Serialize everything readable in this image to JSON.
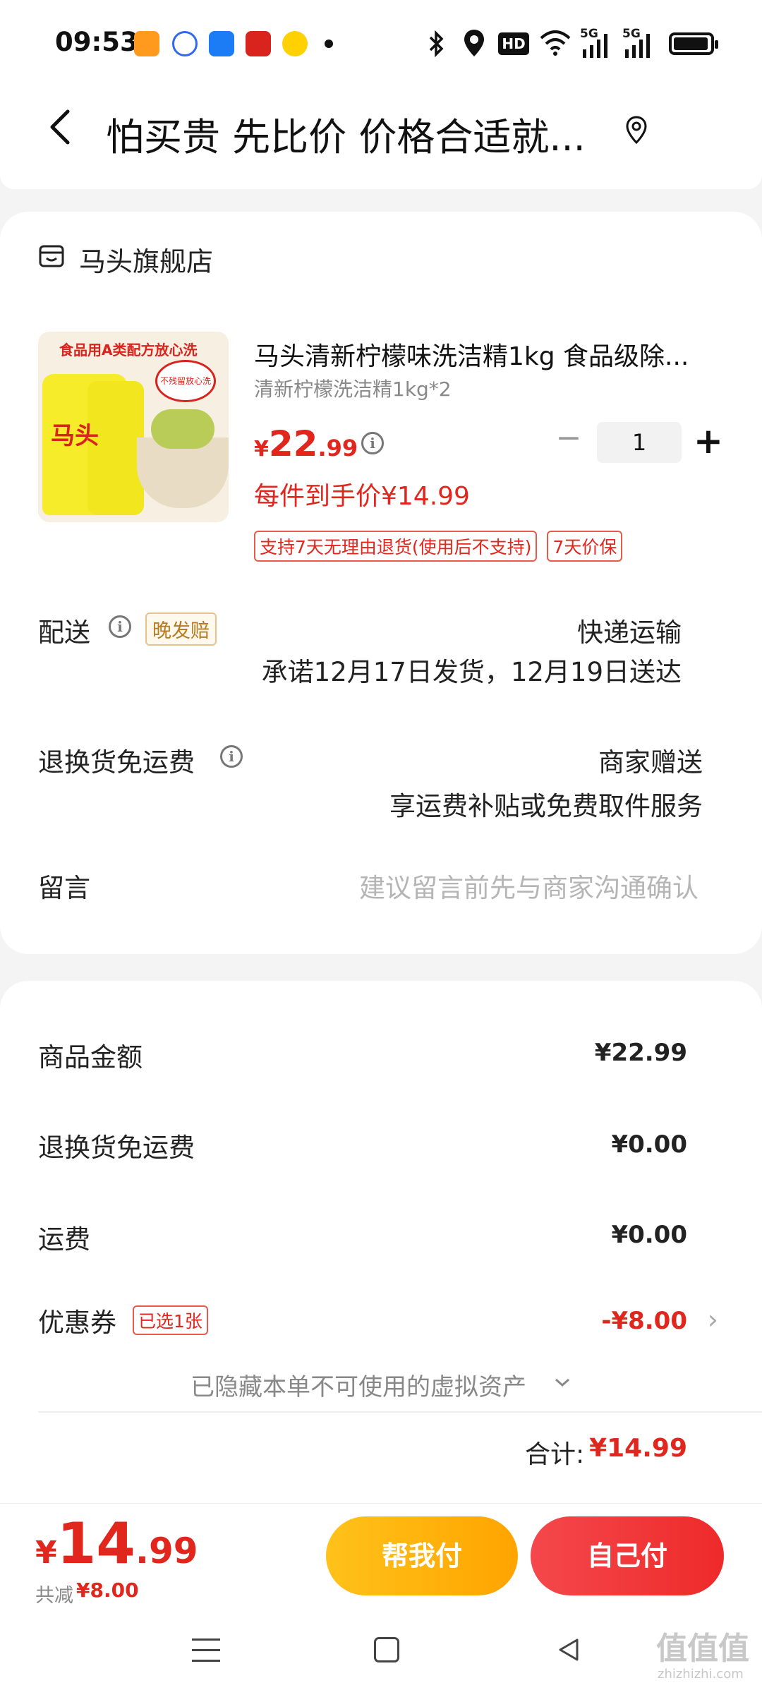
{
  "status_bar": {
    "time": "09:53",
    "hd_label": "HD",
    "net1": "5G",
    "net2": "5G",
    "battery_level": 0.95,
    "app_icons": [
      "taobao-icon",
      "baidu-icon",
      "phone-app-icon",
      "xuexi-app-icon",
      "meituan-icon"
    ]
  },
  "header": {
    "title": "怕买贵 先比价 价格合适就..."
  },
  "order": {
    "shop_name": "马头旗舰店",
    "product": {
      "image_text": "食品用A类配方放心洗",
      "image_badge": "不残留放心洗",
      "image_brand": "马头",
      "title": "马头清新柠檬味洗洁精1kg 食品级除...",
      "spec": "清新柠檬洗洁精1kg*2",
      "price_symbol": "¥",
      "price_int": "22",
      "price_dec": ".99",
      "final_price": "每件到手价¥14.99",
      "quantity": "1",
      "tags": [
        "支持7天无理由退货(使用后不支持)",
        "7天价保"
      ]
    },
    "delivery": {
      "label": "配送",
      "badge": "晚发赔",
      "method": "快递运输",
      "promise": "承诺12月17日发货，12月19日送达"
    },
    "return_shipping": {
      "label": "退换货免运费",
      "value": "商家赠送",
      "desc": "享运费补贴或免费取件服务"
    },
    "note": {
      "label": "留言",
      "placeholder": "建议留言前先与商家沟通确认"
    }
  },
  "summary": {
    "goods_label": "商品金额",
    "goods_value": "¥22.99",
    "return_label": "退换货免运费",
    "return_value": "¥0.00",
    "shipping_label": "运费",
    "shipping_value": "¥0.00",
    "coupon_label": "优惠券",
    "coupon_badge": "已选1张",
    "coupon_value": "-¥8.00",
    "hidden_assets": "已隐藏本单不可使用的虚拟资产",
    "total_label": "合计:",
    "total_value": "¥14.99"
  },
  "bottom_bar": {
    "price_symbol": "¥",
    "price_int": "14",
    "price_dec": ".99",
    "saved_label": "共减",
    "saved_value": "¥8.00",
    "help_pay": "帮我付",
    "self_pay": "自己付"
  },
  "watermark": {
    "text": "值值值",
    "url": "zhizhizhi.com"
  },
  "colors": {
    "accent_red": "#e0261d",
    "help_button": "#ffb300",
    "self_button": "#f0383a"
  }
}
